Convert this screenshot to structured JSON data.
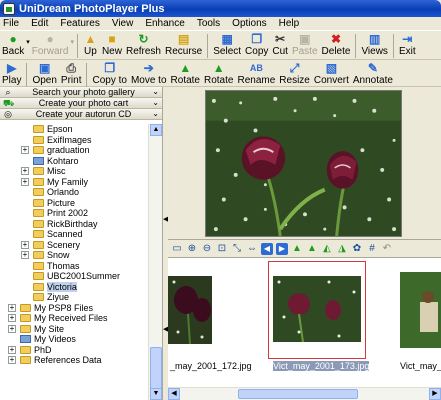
{
  "window": {
    "title": "UniDream PhotoPlayer Plus"
  },
  "menu": [
    "File",
    "Edit",
    "Features",
    "View",
    "Enhance",
    "Tools",
    "Options",
    "Help"
  ],
  "toolbar1": [
    {
      "label": "Back",
      "icon": "back-icon",
      "disabled": false
    },
    {
      "label": "Forward",
      "icon": "forward-icon",
      "disabled": true
    },
    {
      "label": "Up",
      "icon": "up-icon",
      "disabled": false
    },
    {
      "label": "New",
      "icon": "new-icon",
      "disabled": false
    },
    {
      "label": "Refresh",
      "icon": "refresh-icon",
      "disabled": false
    },
    {
      "label": "Recurse",
      "icon": "recurse-icon",
      "disabled": false
    },
    {
      "label": "Select",
      "icon": "select-icon",
      "disabled": false
    },
    {
      "label": "Copy",
      "icon": "copy-icon",
      "disabled": false
    },
    {
      "label": "Cut",
      "icon": "cut-icon",
      "disabled": false
    },
    {
      "label": "Paste",
      "icon": "paste-icon",
      "disabled": true
    },
    {
      "label": "Delete",
      "icon": "delete-icon",
      "disabled": false
    },
    {
      "label": "Views",
      "icon": "views-icon",
      "disabled": false
    },
    {
      "label": "Exit",
      "icon": "exit-icon",
      "disabled": false
    }
  ],
  "toolbar2": [
    {
      "label": "Play",
      "icon": "play-icon"
    },
    {
      "label": "Open",
      "icon": "open-icon"
    },
    {
      "label": "Print",
      "icon": "print-icon"
    },
    {
      "label": "Copy to",
      "icon": "copy-to-icon"
    },
    {
      "label": "Move to",
      "icon": "move-to-icon"
    },
    {
      "label": "Rotate",
      "icon": "rotate-left-icon"
    },
    {
      "label": "Rotate",
      "icon": "rotate-right-icon"
    },
    {
      "label": "Rename",
      "icon": "rename-icon"
    },
    {
      "label": "Resize",
      "icon": "resize-icon"
    },
    {
      "label": "Convert",
      "icon": "convert-icon"
    },
    {
      "label": "Annotate",
      "icon": "annotate-icon"
    }
  ],
  "panels": [
    {
      "label": "Search your photo gallery",
      "icon": "search-icon"
    },
    {
      "label": "Create your photo cart",
      "icon": "cart-icon"
    },
    {
      "label": "Create your autorun CD",
      "icon": "cd-icon"
    }
  ],
  "tree": [
    {
      "label": "Epson",
      "level": 2,
      "expand": false,
      "kind": "folder",
      "selected": false
    },
    {
      "label": "ExifImages",
      "level": 2,
      "expand": false,
      "kind": "folder",
      "selected": false
    },
    {
      "label": "graduation",
      "level": 2,
      "expand": true,
      "kind": "folder",
      "selected": false
    },
    {
      "label": "Kohtaro",
      "level": 2,
      "expand": false,
      "kind": "special",
      "selected": false
    },
    {
      "label": "Misc",
      "level": 2,
      "expand": true,
      "kind": "folder",
      "selected": false
    },
    {
      "label": "My Family",
      "level": 2,
      "expand": true,
      "kind": "folder",
      "selected": false
    },
    {
      "label": "Orlando",
      "level": 2,
      "expand": false,
      "kind": "folder",
      "selected": false
    },
    {
      "label": "Picture",
      "level": 2,
      "expand": false,
      "kind": "folder",
      "selected": false
    },
    {
      "label": "Print 2002",
      "level": 2,
      "expand": false,
      "kind": "folder",
      "selected": false
    },
    {
      "label": "RickBirthday",
      "level": 2,
      "expand": false,
      "kind": "folder",
      "selected": false
    },
    {
      "label": "Scanned",
      "level": 2,
      "expand": false,
      "kind": "folder",
      "selected": false
    },
    {
      "label": "Scenery",
      "level": 2,
      "expand": true,
      "kind": "folder",
      "selected": false
    },
    {
      "label": "Snow",
      "level": 2,
      "expand": true,
      "kind": "folder",
      "selected": false
    },
    {
      "label": "Thomas",
      "level": 2,
      "expand": false,
      "kind": "folder",
      "selected": false
    },
    {
      "label": "UBC2001Summer",
      "level": 2,
      "expand": false,
      "kind": "folder",
      "selected": false
    },
    {
      "label": "Victoria",
      "level": 2,
      "expand": false,
      "kind": "folder",
      "selected": true
    },
    {
      "label": "Ziyue",
      "level": 2,
      "expand": false,
      "kind": "folder",
      "selected": false
    },
    {
      "label": "My PSP8 Files",
      "level": 1,
      "expand": true,
      "kind": "folder",
      "selected": false
    },
    {
      "label": "My Received Files",
      "level": 1,
      "expand": true,
      "kind": "folder",
      "selected": false
    },
    {
      "label": "My Site",
      "level": 1,
      "expand": true,
      "kind": "folder",
      "selected": false
    },
    {
      "label": "My Videos",
      "level": 1,
      "expand": false,
      "kind": "special",
      "selected": false
    },
    {
      "label": "PhD",
      "level": 1,
      "expand": true,
      "kind": "folder",
      "selected": false
    },
    {
      "label": "References Data",
      "level": 1,
      "expand": true,
      "kind": "folder",
      "selected": false
    }
  ],
  "thumbnails": [
    {
      "caption": "_may_2001_172.jpg",
      "selected": false
    },
    {
      "caption": "Vict_may_2001_173.jpg",
      "selected": true
    },
    {
      "caption": "Vict_may_2001_174",
      "selected": false
    }
  ],
  "colors": {
    "selection_border": "#d23a3a",
    "title_blue": "#0a3fb4"
  }
}
